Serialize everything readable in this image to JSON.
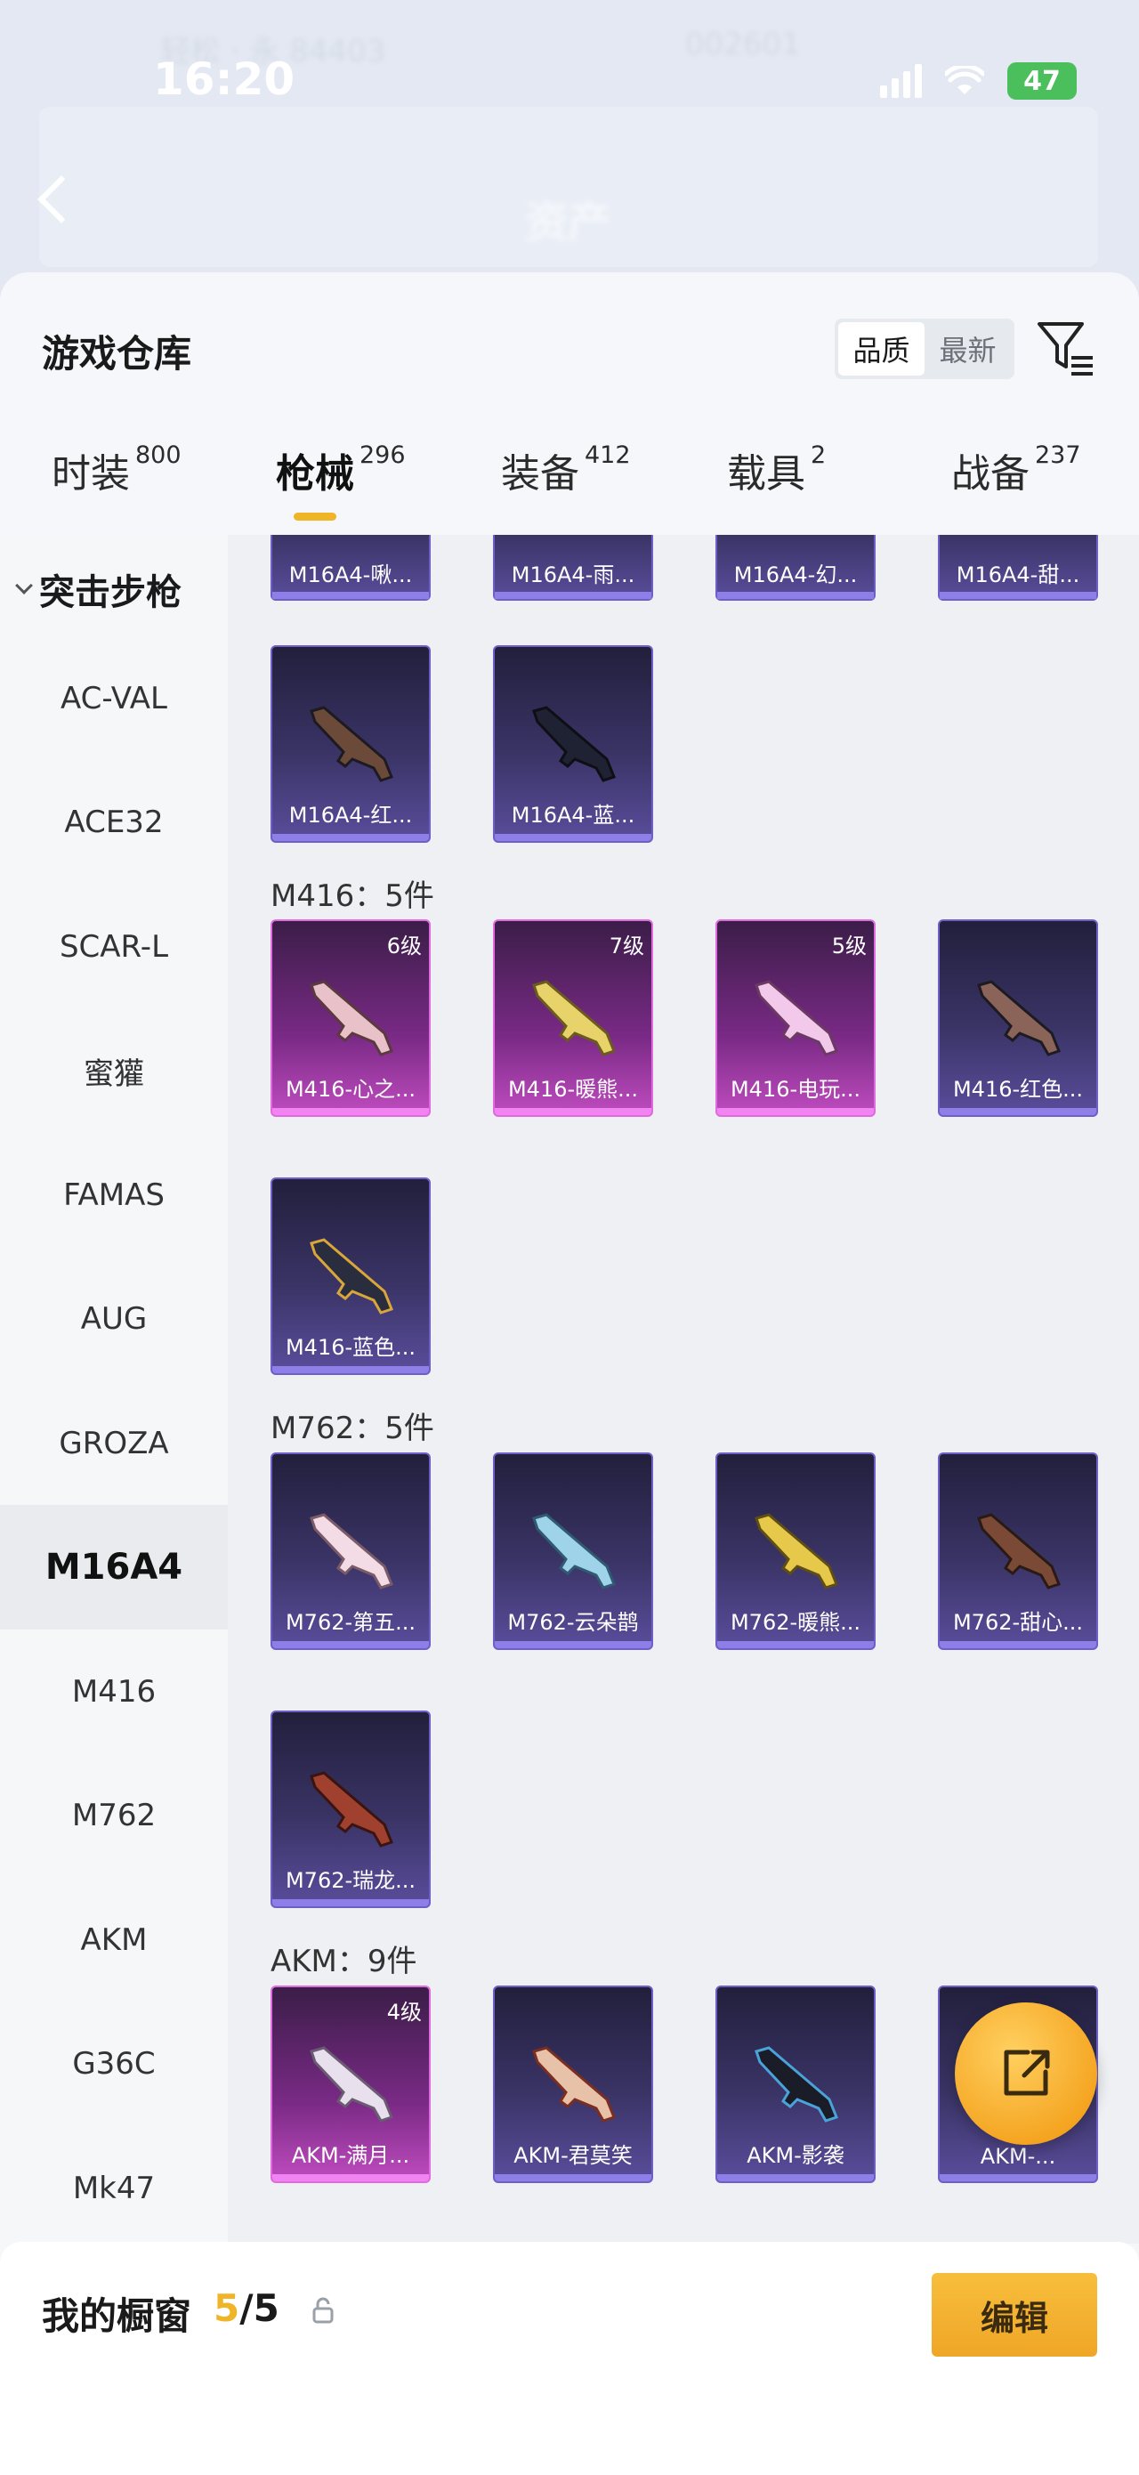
{
  "status_bar": {
    "time": "16:20",
    "battery": "47",
    "faded_top_left": "轻松 · 永 84403",
    "faded_top_right": "002601"
  },
  "page_header": {
    "title": "资产"
  },
  "sheet": {
    "title": "游戏仓库",
    "sort": {
      "quality_label": "品质",
      "newest_label": "最新",
      "selected": "品质"
    }
  },
  "tabs": [
    {
      "label": "时装",
      "count": "800"
    },
    {
      "label": "枪械",
      "count": "296",
      "active": true
    },
    {
      "label": "装备",
      "count": "412"
    },
    {
      "label": "载具",
      "count": "2"
    },
    {
      "label": "战备",
      "count": "237"
    }
  ],
  "sidebar": {
    "group": "突击步枪",
    "items": [
      "AC-VAL",
      "ACE32",
      "SCAR-L",
      "蜜獾",
      "FAMAS",
      "AUG",
      "GROZA",
      "M16A4",
      "M416",
      "M762",
      "AKM",
      "G36C",
      "Mk47"
    ],
    "active": "M16A4"
  },
  "content": {
    "partial_row": [
      "M16A4-啾...",
      "M16A4-雨...",
      "M16A4-幻...",
      "M16A4-甜..."
    ],
    "m16a4_row2": [
      {
        "name": "M16A4-红...",
        "level": ""
      },
      {
        "name": "M16A4-蓝...",
        "level": ""
      }
    ],
    "m416_header": "M416：5件",
    "m416_items": [
      {
        "name": "M416-心之...",
        "level": "6级"
      },
      {
        "name": "M416-暖熊...",
        "level": "7级"
      },
      {
        "name": "M416-电玩...",
        "level": "5级"
      },
      {
        "name": "M416-红色...",
        "level": ""
      },
      {
        "name": "M416-蓝色...",
        "level": ""
      }
    ],
    "m762_header": "M762：5件",
    "m762_items": [
      {
        "name": "M762-第五...",
        "level": ""
      },
      {
        "name": "M762-云朵鹊",
        "level": ""
      },
      {
        "name": "M762-暖熊...",
        "level": ""
      },
      {
        "name": "M762-甜心...",
        "level": ""
      },
      {
        "name": "M762-瑞龙...",
        "level": ""
      }
    ],
    "akm_header": "AKM：9件",
    "akm_items": [
      {
        "name": "AKM-满月...",
        "level": "4级"
      },
      {
        "name": "AKM-君莫笑",
        "level": ""
      },
      {
        "name": "AKM-影袭",
        "level": ""
      },
      {
        "name": "AKM-...",
        "level": ""
      }
    ]
  },
  "showcase": {
    "label": "我的橱窗",
    "current": "5",
    "total": "/5",
    "edit_label": "编辑"
  },
  "colors": {
    "accent": "#f0b429",
    "card_purple": "#5a4d9c",
    "card_pink": "#c04cc0"
  }
}
